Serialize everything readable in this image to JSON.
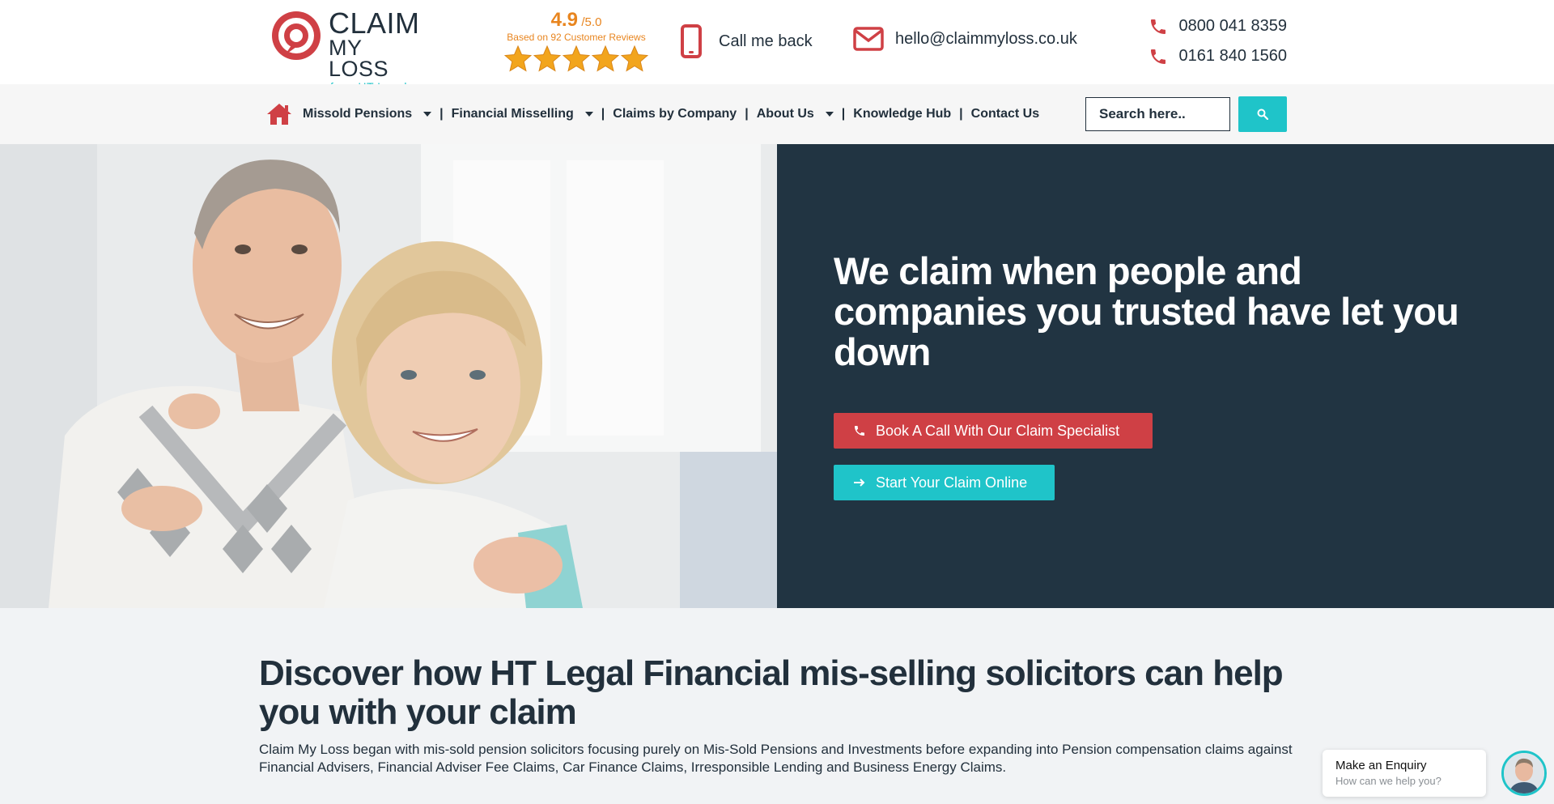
{
  "header": {
    "logo": {
      "line1": "CLAIM",
      "line2": "MY LOSS",
      "line3": "from HT Legal"
    },
    "rating": {
      "score": "4.9",
      "max": "/5.0",
      "based_on": "Based on 92 Customer Reviews",
      "stars": 5,
      "star_color": "#f2a51d"
    },
    "callback_label": "Call me back",
    "email": "hello@claimmyloss.co.uk",
    "phones": [
      "0800 041 8359",
      "0161 840 1560"
    ]
  },
  "nav": {
    "items": [
      {
        "label": "Missold Pensions"
      },
      {
        "label": "Financial Misselling"
      },
      {
        "label": "Claims by Company"
      },
      {
        "label": "About Us"
      },
      {
        "label": "Knowledge Hub"
      },
      {
        "label": "Contact Us"
      }
    ],
    "separator": "|",
    "search_placeholder": "Search here.."
  },
  "hero": {
    "title": "We claim when people and companies you trusted have let you down",
    "primary_button": "Book A Call With Our Claim Specialist",
    "secondary_button": "Start Your Claim Online"
  },
  "discover": {
    "title": "Discover how HT Legal Financial mis-selling solicitors can help you with your claim",
    "text": "Claim My Loss began with mis-sold pension solicitors focusing purely on Mis-Sold Pensions and Investments before expanding into Pension compensation claims against Financial Advisers, Financial Adviser Fee Claims, Car Finance Claims, Irresponsible Lending and Business Energy Claims."
  },
  "chat": {
    "title": "Make an Enquiry",
    "subtitle": "How can we help you?"
  },
  "colors": {
    "brand_red": "#cf4045",
    "brand_teal": "#1fc4c9",
    "navy": "#213442",
    "rating_orange": "#e8851f"
  }
}
